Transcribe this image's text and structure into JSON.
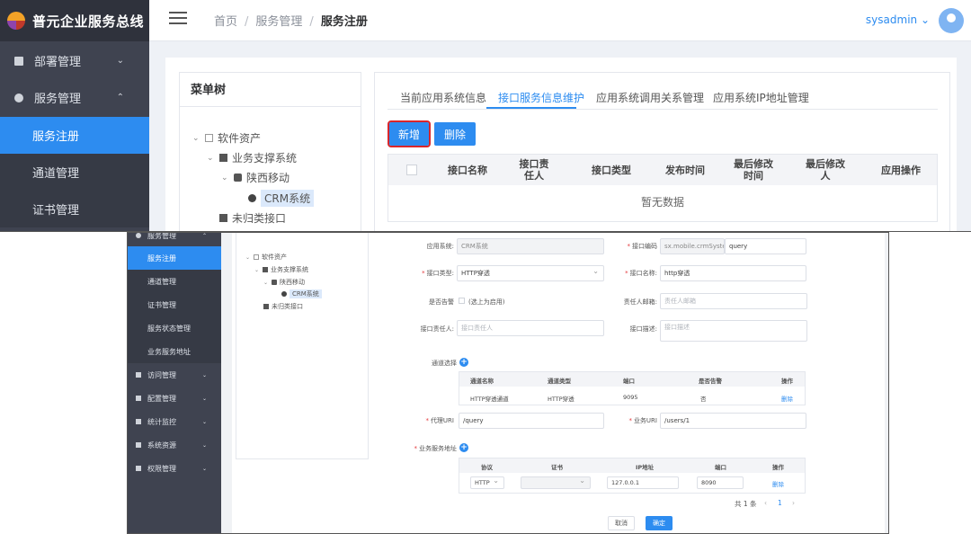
{
  "top": {
    "app_title": "普元企业服务总线",
    "sidebar": {
      "groups": [
        {
          "label": "部署管理",
          "icon": "briefcase-icon",
          "chevron": "⌄"
        },
        {
          "label": "服务管理",
          "icon": "circle-icon",
          "chevron": "⌃"
        }
      ],
      "sub_items": [
        "服务注册",
        "通道管理",
        "证书管理"
      ]
    },
    "breadcrumb": [
      "首页",
      "服务管理",
      "服务注册"
    ],
    "breadcrumb_sep": "/",
    "user": "sysadmin ⌄",
    "tree": {
      "title": "菜单树",
      "nodes": [
        {
          "toggle": "⌄",
          "label": "软件资产"
        },
        {
          "toggle": "⌄",
          "label": "业务支撑系统"
        },
        {
          "toggle": "⌄",
          "label": "陕西移动"
        },
        {
          "toggle": "",
          "label": "CRM系统"
        },
        {
          "toggle": "",
          "label": "未归类接口"
        }
      ]
    },
    "tabs": [
      "当前应用系统信息",
      "接口服务信息维护",
      "应用系统调用关系管理",
      "应用系统IP地址管理"
    ],
    "buttons": {
      "add": "新增",
      "delete": "删除"
    },
    "table_headers": [
      "接口名称",
      "接口责任人",
      "接口类型",
      "发布时间",
      "最后修改时间",
      "最后修改人",
      "应用操作"
    ],
    "empty_text": "暂无数据",
    "colors": {
      "accent": "#2d8cf0",
      "sidebar": "#3f4350",
      "highlight": "#d9262b"
    }
  },
  "bottom": {
    "sidebar": {
      "items": [
        {
          "label": "服务管理",
          "chevron": "⌃"
        },
        {
          "label": "服务注册"
        },
        {
          "label": "通道管理"
        },
        {
          "label": "证书管理"
        },
        {
          "label": "服务状态管理"
        },
        {
          "label": "业务服务地址"
        },
        {
          "label": "访问管理",
          "chevron": "⌄"
        },
        {
          "label": "配置管理",
          "chevron": "⌄"
        },
        {
          "label": "统计监控",
          "chevron": "⌄"
        },
        {
          "label": "系统资源",
          "chevron": "⌄"
        },
        {
          "label": "权限管理",
          "chevron": "⌄"
        }
      ]
    },
    "tree": {
      "nodes": [
        {
          "toggle": "⌄",
          "label": "软件资产"
        },
        {
          "toggle": "⌄",
          "label": "业务支撑系统"
        },
        {
          "toggle": "⌄",
          "label": "陕西移动"
        },
        {
          "toggle": "",
          "label": "CRM系统"
        },
        {
          "toggle": "",
          "label": "未归类接口"
        }
      ]
    },
    "form": {
      "app_system": {
        "label": "应用系统:",
        "value": "CRM系统"
      },
      "interface_code": {
        "label": "接口编码",
        "prefix": "sx.mobile.crmSystem.",
        "value": "query"
      },
      "interface_type": {
        "label": "接口类型:",
        "value": "HTTP穿透"
      },
      "interface_name": {
        "label": "接口名称:",
        "value": "http穿透"
      },
      "alert": {
        "label": "是否告警",
        "option": "(选上为启用)"
      },
      "owner_email": {
        "label": "责任人邮箱:",
        "placeholder": "责任人邮箱"
      },
      "owner": {
        "label": "接口责任人:",
        "placeholder": "接口责任人"
      },
      "description": {
        "label": "接口描述:",
        "placeholder": "接口描述"
      },
      "channel_select": {
        "label": "通道选择"
      },
      "channel_table": {
        "headers": [
          "通道名称",
          "通道类型",
          "端口",
          "是否告警",
          "操作"
        ],
        "row": [
          "HTTP穿透通道",
          "HTTP穿透",
          "9095",
          "否",
          "删除"
        ]
      },
      "proxy_uri": {
        "label": "代理URI",
        "value": "/query"
      },
      "business_uri": {
        "label": "业务URI",
        "value": "/users/1"
      },
      "service_address": {
        "label": "业务服务地址"
      },
      "address_table": {
        "headers": [
          "协议",
          "证书",
          "IP地址",
          "端口",
          "操作"
        ],
        "row": {
          "protocol": "HTTP",
          "cert": "",
          "ip": "127.0.0.1",
          "port": "8090",
          "action": "删除"
        }
      },
      "pager": {
        "total": "共 1 条",
        "prev": "‹",
        "page": "1",
        "next": "›"
      },
      "cancel": "取消",
      "confirm": "确定"
    }
  }
}
